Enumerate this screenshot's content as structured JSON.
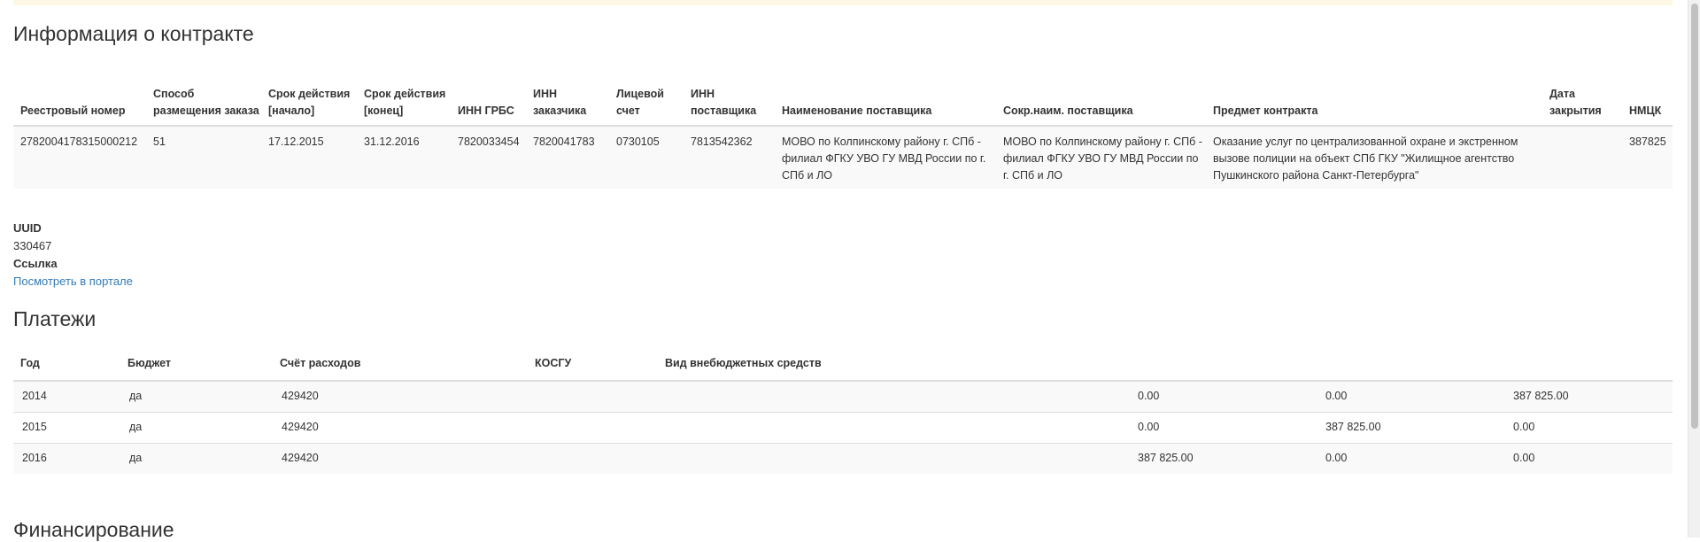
{
  "contract": {
    "title": "Информация о контракте",
    "headers": [
      "Реестровый номер",
      "Способ размещения заказа",
      "Срок действия [начало]",
      "Срок действия [конец]",
      "ИНН ГРБС",
      "ИНН заказчика",
      "Лицевой счет",
      "ИНН поставщика",
      "Наименование поставщика",
      "Сокр.наим. поставщика",
      "Предмет контракта",
      "Дата закрытия",
      "НМЦК"
    ],
    "row": [
      "2782004178315000212",
      "51",
      "17.12.2015",
      "31.12.2016",
      "7820033454",
      "7820041783",
      "0730105",
      "7813542362",
      "МОВО по Колпинскому району г. СПб - филиал ФГКУ УВО ГУ МВД России по г. СПб и ЛО",
      "МОВО по Колпинскому району г. СПб - филиал ФГКУ УВО ГУ МВД России по г. СПб и ЛО",
      "Оказание услуг по централизованной охране и экстренном вызове полиции на объект СПб ГКУ \"Жилищное агентство Пушкинского района Санкт-Петербурга\"",
      "",
      "387825"
    ]
  },
  "info": {
    "uuid_label": "UUID",
    "uuid_value": "330467",
    "link_label": "Ссылка",
    "link_text": "Посмотреть в портале"
  },
  "payments": {
    "title": "Платежи",
    "headers": [
      "Год",
      "Бюджет",
      "Счёт расходов",
      "КОСГУ",
      "Вид внебюджетных средств",
      "",
      "",
      ""
    ],
    "rows": [
      [
        "2014",
        "да",
        "429420",
        "",
        "",
        "0.00",
        "0.00",
        "387 825.00"
      ],
      [
        "2015",
        "да",
        "429420",
        "",
        "",
        "0.00",
        "387 825.00",
        "0.00"
      ],
      [
        "2016",
        "да",
        "429420",
        "",
        "",
        "387 825.00",
        "0.00",
        "0.00"
      ]
    ]
  },
  "financing": {
    "title": "Финансирование"
  }
}
